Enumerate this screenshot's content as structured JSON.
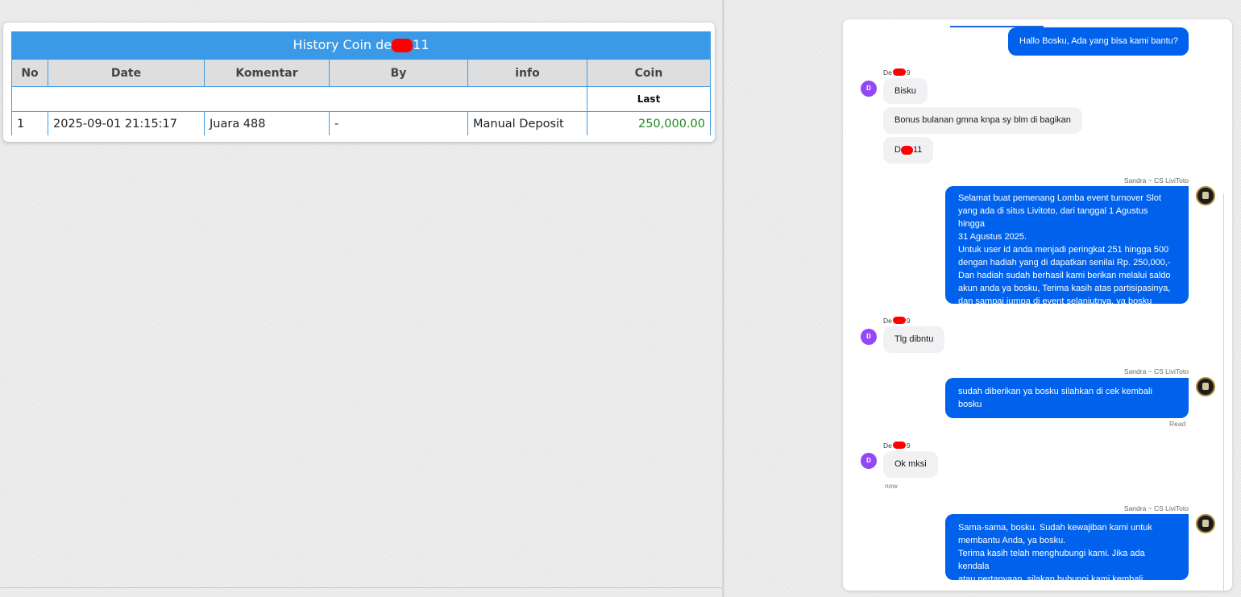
{
  "history": {
    "title_prefix": "History Coin de",
    "title_suffix": "11",
    "columns": [
      "No",
      "Date",
      "Komentar",
      "By",
      "info",
      "Coin"
    ],
    "last_label": "Last",
    "rows": [
      {
        "no": "1",
        "date": "2025-09-01 21:15:17",
        "komentar": "Juara 488",
        "by": "-",
        "info": "Manual Deposit",
        "coin": "250,000.00"
      }
    ]
  },
  "chat": {
    "agent_name": "Sandra ~ CS LiviToto",
    "user_name_prefix": "De",
    "user_name_suffix": "9",
    "user_avatar_letter": "D",
    "messages": {
      "m1": "Hallo Bosku, Ada yang bisa kami bantu?",
      "m2": "Bisku",
      "m3": "Bonus bulanan gmna knpa sy blm di bagikan",
      "m4_prefix": "D",
      "m4_suffix": "11",
      "m5": [
        "Selamat buat pemenang Lomba event turnover Slot",
        "yang ada di situs Livitoto, dari tanggal 1 Agustus hingga",
        "31 Agustus 2025.",
        "Untuk user id anda menjadi peringkat 251 hingga 500",
        "dengan hadiah yang di dapatkan senilai Rp. 250,000,-",
        "Dan hadiah sudah berhasil kami berikan melalui saldo",
        "akun anda ya bosku, Terima kasih atas partisipasinya,",
        "dan sampai jumpa di event selanjutnya, ya bosku"
      ],
      "m6": "Tlg dibntu",
      "m7": [
        "sudah diberikan ya bosku silahkan di cek kembali",
        "bosku"
      ],
      "m8": "Ok mksi",
      "m9": [
        "Sama-sama, bosku. Sudah kewajiban kami untuk",
        "membantu Anda, ya bosku.",
        "Terima kasih telah menghubungi kami. Jika ada kendala",
        "atau pertanyaan, silakan hubungi kami kembali."
      ]
    },
    "read_label": "Read",
    "now_label": "now"
  },
  "colors": {
    "header_blue": "#3b9ae7",
    "bubble_blue": "#0062ec",
    "avatar_purple": "#9447f5",
    "coin_green": "#1b8a1b",
    "redaction_red": "#ff0000"
  }
}
